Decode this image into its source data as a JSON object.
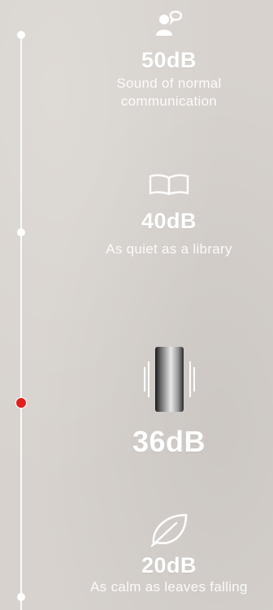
{
  "colors": {
    "background": "#d7d2cd",
    "text": "#ffffff",
    "active_dot": "#e0201c"
  },
  "levels": [
    {
      "icon": "speech-bubble-person-icon",
      "db": "50dB",
      "description_lines": [
        "Sound of normal",
        "communication"
      ]
    },
    {
      "icon": "open-book-icon",
      "db": "40dB",
      "description_lines": [
        "As quiet as a library"
      ]
    },
    {
      "icon": "vibrating-device-icon",
      "db": "36dB",
      "description_lines": [],
      "active": true
    },
    {
      "icon": "leaf-icon",
      "db": "20dB",
      "description_lines": [
        "As calm as leaves falling"
      ]
    }
  ]
}
